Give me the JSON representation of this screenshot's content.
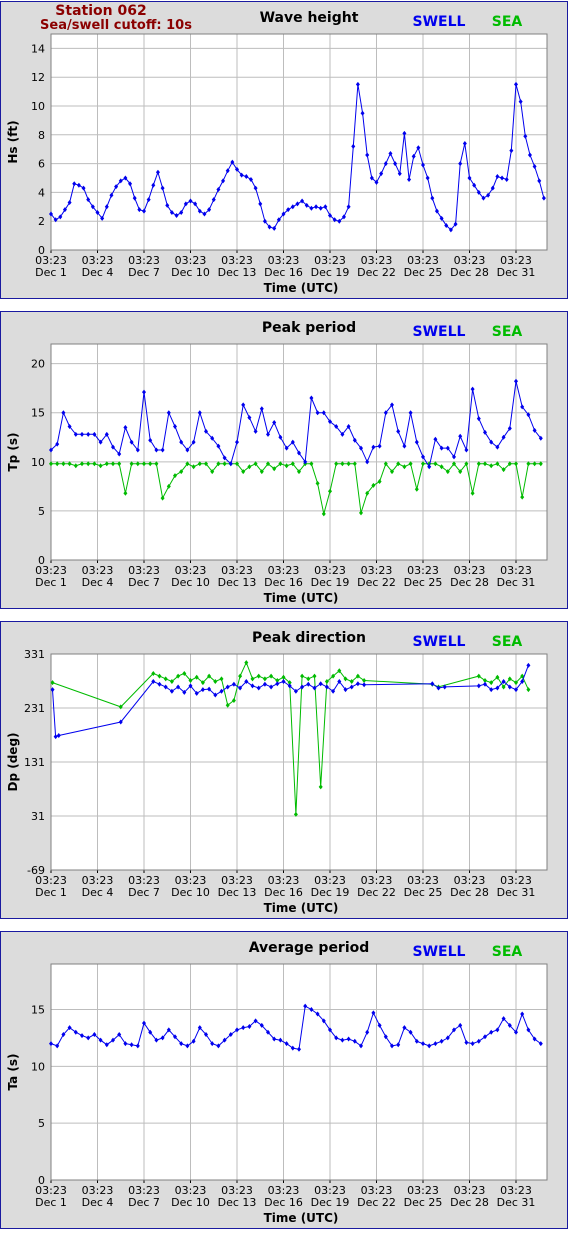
{
  "header": {
    "station": "Station 062",
    "cutoff": "Sea/swell cutoff: 10s"
  },
  "legend": {
    "swell_label": "SWELL",
    "sea_label": "SEA",
    "swell_color": "#0000ee",
    "sea_color": "#00bb00"
  },
  "xaxis": {
    "label": "Time (UTC)",
    "time_label": "03:23",
    "dates": [
      "Dec 1",
      "Dec 4",
      "Dec 7",
      "Dec 10",
      "Dec 13",
      "Dec 16",
      "Dec 19",
      "Dec 22",
      "Dec 25",
      "Dec 28",
      "Dec 31"
    ]
  },
  "chart_data": [
    {
      "type": "line",
      "title": "Wave height",
      "ylabel": "Hs (ft)",
      "ylim": [
        0,
        15
      ],
      "yticks": [
        "0",
        "2",
        "4",
        "6",
        "8",
        "10",
        "12",
        "14"
      ],
      "grid": true,
      "xlim": [
        0,
        32
      ],
      "series": [
        {
          "name": "SWELL",
          "x": [
            0,
            0.3,
            0.6,
            0.9,
            1.2,
            1.5,
            1.8,
            2.1,
            2.4,
            2.7,
            3.0,
            3.3,
            3.6,
            3.9,
            4.2,
            4.5,
            4.8,
            5.1,
            5.4,
            5.7,
            6.0,
            6.3,
            6.6,
            6.9,
            7.2,
            7.5,
            7.8,
            8.1,
            8.4,
            8.7,
            9.0,
            9.3,
            9.6,
            9.9,
            10.2,
            10.5,
            10.8,
            11.1,
            11.4,
            11.7,
            12.0,
            12.3,
            12.6,
            12.9,
            13.2,
            13.5,
            13.8,
            14.1,
            14.4,
            14.7,
            15.0,
            15.3,
            15.6,
            15.9,
            16.2,
            16.5,
            16.8,
            17.1,
            17.4,
            17.7,
            18.0,
            18.3,
            18.6,
            18.9,
            19.2,
            19.5,
            19.8,
            20.1,
            20.4,
            20.7,
            21.0,
            21.3,
            21.6,
            21.9,
            22.2,
            22.5,
            22.8,
            23.1,
            23.4,
            23.7,
            24.0,
            24.3,
            24.6,
            24.9,
            25.2,
            25.5,
            25.8,
            26.1,
            26.4,
            26.7,
            27.0,
            27.3,
            27.6,
            27.9,
            28.2,
            28.5,
            28.8,
            29.1,
            29.4,
            29.7,
            30.0,
            30.3,
            30.6,
            30.9,
            31.2,
            31.5,
            31.8
          ],
          "y": [
            2.5,
            2.1,
            2.3,
            2.8,
            3.3,
            4.6,
            4.5,
            4.3,
            3.5,
            3.0,
            2.6,
            2.2,
            3.0,
            3.8,
            4.4,
            4.8,
            5.0,
            4.6,
            3.6,
            2.8,
            2.7,
            3.5,
            4.5,
            5.4,
            4.3,
            3.1,
            2.6,
            2.4,
            2.6,
            3.2,
            3.4,
            3.2,
            2.7,
            2.5,
            2.8,
            3.5,
            4.2,
            4.8,
            5.5,
            6.1,
            5.6,
            5.2,
            5.1,
            4.9,
            4.3,
            3.2,
            2.0,
            1.6,
            1.5,
            2.1,
            2.5,
            2.8,
            3.0,
            3.2,
            3.4,
            3.1,
            2.9,
            3.0,
            2.9,
            3.0,
            2.4,
            2.1,
            2.0,
            2.3,
            3.0,
            7.2,
            11.5,
            9.5,
            6.6,
            5.0,
            4.7,
            5.3,
            6.0,
            6.7,
            6.0,
            5.3,
            8.1,
            4.9,
            6.5,
            7.1,
            5.9,
            5.0,
            3.6,
            2.7,
            2.2,
            1.7,
            1.4,
            1.8,
            6.0,
            7.4,
            5.0,
            4.5,
            4.0,
            3.6,
            3.8,
            4.3,
            5.1,
            5.0,
            4.9,
            6.9,
            11.5,
            10.3,
            7.9,
            6.6,
            5.8,
            4.8,
            3.6
          ]
        }
      ]
    },
    {
      "type": "line",
      "title": "Peak period",
      "ylabel": "Tp (s)",
      "ylim": [
        0,
        22
      ],
      "yticks": [
        "0",
        "5",
        "10",
        "15",
        "20"
      ],
      "grid": true,
      "xlim": [
        0,
        32
      ],
      "series": [
        {
          "name": "SWELL",
          "x": [
            0,
            0.4,
            0.8,
            1.2,
            1.6,
            2.0,
            2.4,
            2.8,
            3.2,
            3.6,
            4.0,
            4.4,
            4.8,
            5.2,
            5.6,
            6.0,
            6.4,
            6.8,
            7.2,
            7.6,
            8.0,
            8.4,
            8.8,
            9.2,
            9.6,
            10.0,
            10.4,
            10.8,
            11.2,
            11.6,
            12.0,
            12.4,
            12.8,
            13.2,
            13.6,
            14.0,
            14.4,
            14.8,
            15.2,
            15.6,
            16.0,
            16.4,
            16.8,
            17.2,
            17.6,
            18.0,
            18.4,
            18.8,
            19.2,
            19.6,
            20.0,
            20.4,
            20.8,
            21.2,
            21.6,
            22.0,
            22.4,
            22.8,
            23.2,
            23.6,
            24.0,
            24.4,
            24.8,
            25.2,
            25.6,
            26.0,
            26.4,
            26.8,
            27.2,
            27.6,
            28.0,
            28.4,
            28.8,
            29.2,
            29.6,
            30.0,
            30.4,
            30.8,
            31.2,
            31.6
          ],
          "y": [
            11.2,
            11.8,
            15.0,
            13.6,
            12.8,
            12.8,
            12.8,
            12.8,
            12.0,
            12.8,
            11.5,
            10.8,
            13.5,
            12.0,
            11.2,
            17.1,
            12.2,
            11.2,
            11.2,
            15.0,
            13.6,
            12.0,
            11.2,
            12.0,
            15.0,
            13.1,
            12.4,
            11.6,
            10.4,
            9.8,
            12.0,
            15.8,
            14.5,
            13.1,
            15.4,
            12.8,
            14.0,
            12.5,
            11.4,
            12.0,
            10.9,
            10.0,
            16.5,
            15.0,
            15.0,
            14.1,
            13.6,
            12.8,
            13.6,
            12.2,
            11.4,
            10.0,
            11.5,
            11.6,
            15.0,
            15.8,
            13.1,
            11.6,
            15.0,
            12.0,
            10.5,
            9.5,
            12.3,
            11.4,
            11.4,
            10.5,
            12.6,
            11.2,
            17.4,
            14.4,
            13.0,
            12.0,
            11.5,
            12.5,
            13.4,
            18.2,
            15.6,
            14.8,
            13.2,
            12.4
          ]
        },
        {
          "name": "SEA",
          "x": [
            0,
            0.4,
            0.8,
            1.2,
            1.6,
            2.0,
            2.4,
            2.8,
            3.2,
            3.6,
            4.0,
            4.4,
            4.8,
            5.2,
            5.6,
            6.0,
            6.4,
            6.8,
            7.2,
            7.6,
            8.0,
            8.4,
            8.8,
            9.2,
            9.6,
            10.0,
            10.4,
            10.8,
            11.2,
            11.6,
            12.0,
            12.4,
            12.8,
            13.2,
            13.6,
            14.0,
            14.4,
            14.8,
            15.2,
            15.6,
            16.0,
            16.4,
            16.8,
            17.2,
            17.6,
            18.0,
            18.4,
            18.8,
            19.2,
            19.6,
            20.0,
            20.4,
            20.8,
            21.2,
            21.6,
            22.0,
            22.4,
            22.8,
            23.2,
            23.6,
            24.0,
            24.4,
            24.8,
            25.2,
            25.6,
            26.0,
            26.4,
            26.8,
            27.2,
            27.6,
            28.0,
            28.4,
            28.8,
            29.2,
            29.6,
            30.0,
            30.4,
            30.8,
            31.2,
            31.6
          ],
          "y": [
            9.8,
            9.8,
            9.8,
            9.8,
            9.6,
            9.8,
            9.8,
            9.8,
            9.6,
            9.8,
            9.8,
            9.8,
            6.8,
            9.8,
            9.8,
            9.8,
            9.8,
            9.8,
            6.3,
            7.5,
            8.6,
            9.0,
            9.8,
            9.5,
            9.8,
            9.8,
            9.0,
            9.8,
            9.8,
            9.8,
            9.8,
            9.0,
            9.5,
            9.8,
            9.0,
            9.8,
            9.3,
            9.8,
            9.6,
            9.8,
            9.0,
            9.8,
            9.8,
            7.8,
            4.7,
            7.0,
            9.8,
            9.8,
            9.8,
            9.8,
            4.8,
            6.8,
            7.6,
            8.0,
            9.8,
            9.0,
            9.8,
            9.5,
            9.8,
            7.2,
            9.8,
            9.8,
            9.8,
            9.5,
            9.0,
            9.8,
            9.0,
            9.8,
            6.8,
            9.8,
            9.8,
            9.6,
            9.8,
            9.2,
            9.8,
            9.8,
            6.4,
            9.8,
            9.8,
            9.8
          ]
        }
      ]
    },
    {
      "type": "scatter",
      "title": "Peak direction",
      "ylabel": "Dp (deg)",
      "ylim": [
        -69,
        331
      ],
      "yticks": [
        "-69",
        "31",
        "131",
        "231",
        "331"
      ],
      "grid": true,
      "xlim": [
        0,
        32
      ],
      "series": [
        {
          "name": "SWELL",
          "x": [
            0.1,
            0.3,
            0.5,
            4.5,
            6.6,
            7.0,
            7.4,
            7.8,
            8.2,
            8.6,
            9.0,
            9.4,
            9.8,
            10.2,
            10.6,
            11.0,
            11.4,
            11.8,
            12.2,
            12.6,
            13.0,
            13.4,
            13.8,
            14.2,
            14.6,
            15.0,
            15.4,
            15.8,
            16.2,
            16.6,
            17.0,
            17.4,
            17.8,
            18.2,
            18.6,
            19.0,
            19.4,
            19.8,
            20.2,
            24.6,
            25.0,
            25.4,
            27.6,
            28.0,
            28.4,
            28.8,
            29.2,
            29.6,
            30.0,
            30.4,
            30.8
          ],
          "y": [
            265,
            178,
            180,
            205,
            280,
            275,
            270,
            262,
            270,
            260,
            272,
            258,
            265,
            266,
            255,
            262,
            270,
            275,
            268,
            280,
            272,
            268,
            275,
            270,
            276,
            280,
            272,
            262,
            270,
            275,
            268,
            276,
            270,
            262,
            280,
            265,
            270,
            276,
            274,
            276,
            268,
            270,
            272,
            275,
            265,
            268,
            280,
            270,
            265,
            280,
            310
          ]
        },
        {
          "name": "SEA",
          "x": [
            0.1,
            4.5,
            6.6,
            7.0,
            7.4,
            7.8,
            8.2,
            8.6,
            9.0,
            9.4,
            9.8,
            10.2,
            10.6,
            11.0,
            11.4,
            11.8,
            12.2,
            12.6,
            13.0,
            13.4,
            13.8,
            14.2,
            14.6,
            15.0,
            15.4,
            15.8,
            16.2,
            16.6,
            17.0,
            17.4,
            17.8,
            18.2,
            18.6,
            19.0,
            19.4,
            19.8,
            20.2,
            24.6,
            25.0,
            27.6,
            28.0,
            28.4,
            28.8,
            29.2,
            29.6,
            30.0,
            30.4,
            30.8
          ],
          "y": [
            278,
            233,
            295,
            290,
            285,
            280,
            290,
            295,
            282,
            288,
            278,
            290,
            280,
            285,
            236,
            245,
            290,
            315,
            285,
            290,
            285,
            290,
            282,
            288,
            278,
            34,
            290,
            285,
            290,
            85,
            280,
            290,
            300,
            285,
            280,
            290,
            282,
            275,
            270,
            290,
            282,
            278,
            288,
            270,
            285,
            278,
            290,
            265
          ]
        }
      ]
    },
    {
      "type": "line",
      "title": "Average period",
      "ylabel": "Ta (s)",
      "ylim": [
        0,
        19
      ],
      "yticks": [
        "0",
        "5",
        "10",
        "15"
      ],
      "grid": true,
      "xlim": [
        0,
        32
      ],
      "series": [
        {
          "name": "SWELL",
          "x": [
            0,
            0.4,
            0.8,
            1.2,
            1.6,
            2.0,
            2.4,
            2.8,
            3.2,
            3.6,
            4.0,
            4.4,
            4.8,
            5.2,
            5.6,
            6.0,
            6.4,
            6.8,
            7.2,
            7.6,
            8.0,
            8.4,
            8.8,
            9.2,
            9.6,
            10.0,
            10.4,
            10.8,
            11.2,
            11.6,
            12.0,
            12.4,
            12.8,
            13.2,
            13.6,
            14.0,
            14.4,
            14.8,
            15.2,
            15.6,
            16.0,
            16.4,
            16.8,
            17.2,
            17.6,
            18.0,
            18.4,
            18.8,
            19.2,
            19.6,
            20.0,
            20.4,
            20.8,
            21.2,
            21.6,
            22.0,
            22.4,
            22.8,
            23.2,
            23.6,
            24.0,
            24.4,
            24.8,
            25.2,
            25.6,
            26.0,
            26.4,
            26.8,
            27.2,
            27.6,
            28.0,
            28.4,
            28.8,
            29.2,
            29.6,
            30.0,
            30.4,
            30.8,
            31.2,
            31.6
          ],
          "y": [
            12.0,
            11.8,
            12.8,
            13.4,
            13.0,
            12.7,
            12.5,
            12.8,
            12.3,
            11.9,
            12.3,
            12.8,
            12.0,
            11.9,
            11.8,
            13.8,
            13.0,
            12.3,
            12.5,
            13.2,
            12.6,
            12.0,
            11.8,
            12.2,
            13.4,
            12.8,
            12.0,
            11.8,
            12.3,
            12.8,
            13.2,
            13.4,
            13.5,
            14.0,
            13.6,
            13.0,
            12.4,
            12.3,
            12.0,
            11.6,
            11.5,
            15.3,
            15.0,
            14.6,
            14.0,
            13.2,
            12.5,
            12.3,
            12.4,
            12.2,
            11.8,
            13.0,
            14.7,
            13.6,
            12.6,
            11.8,
            11.9,
            13.4,
            13.0,
            12.2,
            12.0,
            11.8,
            12.0,
            12.2,
            12.5,
            13.2,
            13.6,
            12.1,
            12.0,
            12.2,
            12.6,
            13.0,
            13.2,
            14.2,
            13.6,
            13.0,
            14.6,
            13.2,
            12.4,
            12.0
          ]
        }
      ]
    }
  ]
}
